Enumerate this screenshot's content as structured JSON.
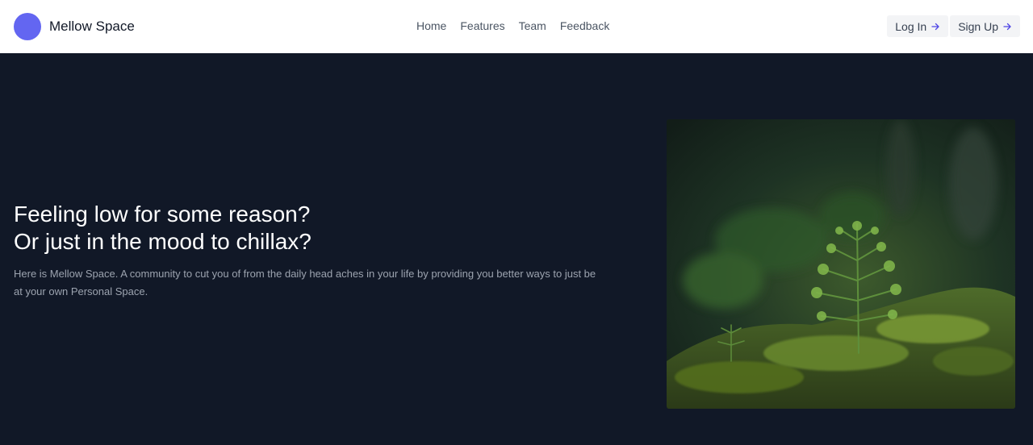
{
  "brand": {
    "name": "Mellow Space",
    "color": "#6366f1"
  },
  "nav": {
    "items": [
      "Home",
      "Features",
      "Team",
      "Feedback"
    ]
  },
  "actions": {
    "login": "Log In",
    "signup": "Sign Up"
  },
  "hero": {
    "title_line1": "Feeling low for some reason?",
    "title_line2": "Or just in the mood to chillax?",
    "description": "Here is Mellow Space. A community to cut you of from the daily head aches in your life by providing you better ways to just be at your own Personal Space.",
    "image_subject": "young fir seedling growing in moss"
  },
  "colors": {
    "hero_bg": "#111827",
    "arrow": "#4f46e5"
  }
}
